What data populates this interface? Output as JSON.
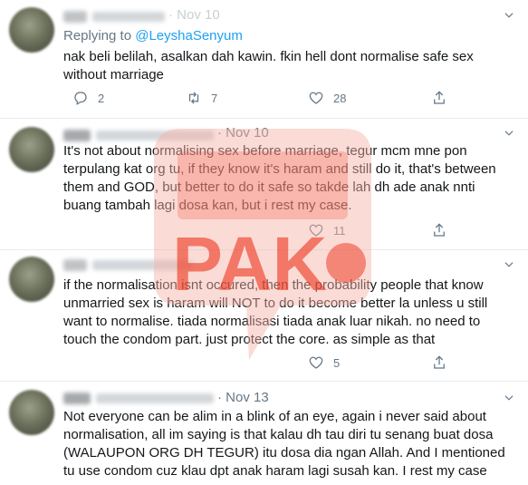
{
  "tweets": [
    {
      "date": "· Nov 10",
      "replying_label": "Replying to",
      "replying_handle": "@LeyshaSenyum",
      "text": "nak beli belilah, asalkan dah kawin. fkin hell dont normalise safe sex without marriage",
      "replies": "2",
      "retweets": "7",
      "likes": "28"
    },
    {
      "date": "· Nov 10",
      "text": "It's not about normalising sex before marriage, tegur mcm mne pon terpulang kat org tu, if they know it's haram and still do it, that's between them and GOD, but better to do it safe so takde lah dh ade anak nnti buang tambah lagi dosa kan, but i rest my case.",
      "likes": "11"
    },
    {
      "text": "if the normalisation isnt occured, then the probability people that know unmarried sex is haram will NOT to do it become better la unless u still want to normalise. tiada normalisasi tiada anak luar nikah. no need to touch the condom part. just protect the core. as simple as that",
      "likes": "5"
    },
    {
      "date": "· Nov 13",
      "text": "Not everyone can be alim in a blink of an eye, again i never said about normalisation, all im saying is that kalau dh tau diri tu senang buat dosa (WALAUPON ORG DH TEGUR) itu dosa dia ngan Allah. And I mentioned tu use condom cuz klau dpt anak haram lagi susah kan. I rest my case"
    }
  ],
  "watermark": {
    "text": "PAK",
    "color": "#f0523c"
  },
  "colors": {
    "link": "#1da1f2",
    "secondary": "#657786",
    "text": "#14171a"
  }
}
